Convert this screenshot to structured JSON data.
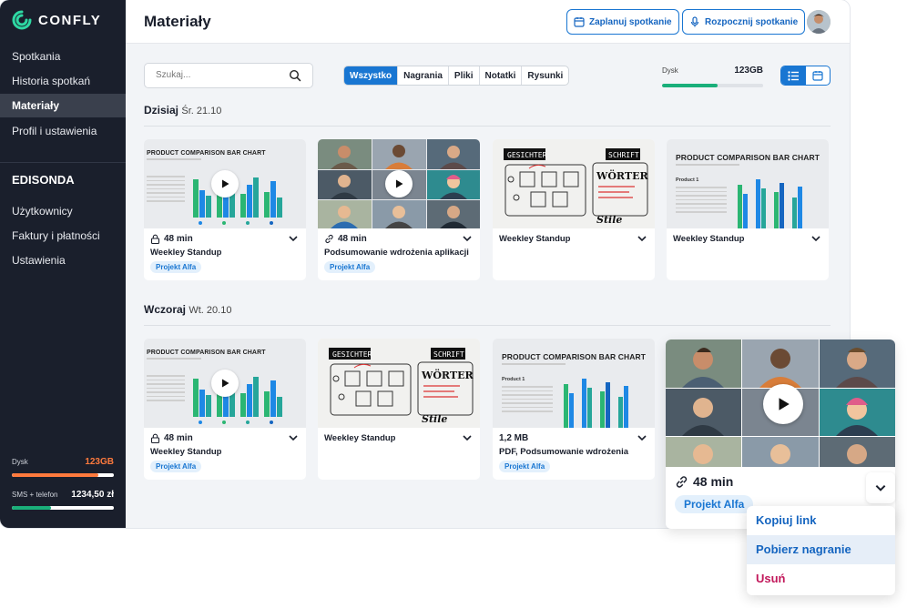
{
  "brand": {
    "name": "CONFLY",
    "accent": "#1976d2",
    "logo_color": "#2ed8a3"
  },
  "sidebar": {
    "items": [
      {
        "label": "Spotkania"
      },
      {
        "label": "Historia spotkań"
      },
      {
        "label": "Materiały",
        "active": true
      },
      {
        "label": "Profil i ustawienia"
      }
    ],
    "org_name": "EDISONDA",
    "org_items": [
      {
        "label": "Użytkownicy"
      },
      {
        "label": "Faktury i płatności"
      },
      {
        "label": "Ustawienia"
      }
    ],
    "usage": [
      {
        "label": "Dysk",
        "value": "123GB",
        "value_color": "#ff7a3d",
        "fill_fraction": 0.85,
        "bar_color": "#ff7a3d"
      },
      {
        "label": "SMS + telefon",
        "value": "1234,50 zł",
        "value_color": "#ffffff",
        "fill_fraction": 0.38,
        "bar_color": "#1aaf7a"
      }
    ]
  },
  "header": {
    "title": "Materiały",
    "schedule_button": "Zaplanuj spotkanie",
    "start_button": "Rozpocznij spotkanie"
  },
  "toolbar": {
    "search_placeholder": "Szukaj...",
    "filters": [
      "Wszystko",
      "Nagrania",
      "Pliki",
      "Notatki",
      "Rysunki"
    ],
    "active_filter": "Wszystko",
    "disk": {
      "label": "Dysk",
      "value": "123GB",
      "fill_fraction": 0.55,
      "bar_color": "#1aaf7a"
    },
    "view": "list"
  },
  "sections": [
    {
      "day": "Dzisiaj",
      "date": "Śr. 21.10",
      "cards": [
        {
          "kind": "chart-video",
          "icon": "lock-icon",
          "meta": "48 min",
          "title": "Weekley Standup",
          "tag": "Projekt Alfa"
        },
        {
          "kind": "people-video",
          "icon": "link-icon",
          "meta": "48 min",
          "title": "Podsumowanie wdrożenia aplikacji",
          "tag": "Projekt Alfa"
        },
        {
          "kind": "sketch",
          "title": "Weekley Standup"
        },
        {
          "kind": "chart-doc",
          "title": "Weekley Standup"
        }
      ]
    },
    {
      "day": "Wczoraj",
      "date": "Wt. 20.10",
      "cards": [
        {
          "kind": "chart-video",
          "icon": "lock-icon",
          "meta": "48 min",
          "title": "Weekley Standup",
          "tag": "Projekt Alfa"
        },
        {
          "kind": "sketch",
          "title": "Weekley Standup"
        },
        {
          "kind": "chart-doc",
          "meta": "1,2 MB",
          "title": "PDF, Podsumowanie wdrożenia",
          "tag": "Projekt Alfa"
        }
      ]
    }
  ],
  "thumb_text": {
    "chart_title": "PRODUCT COMPARISON BAR CHART",
    "product": "Product 1",
    "sketch_a": "GESICHTER",
    "sketch_b": "SCHRIFT",
    "sketch_c": "WÖRTER",
    "sketch_d": "Stile"
  },
  "expanded_card": {
    "meta": "48 min",
    "tag": "Projekt Alfa",
    "icon": "link-icon"
  },
  "context_menu": {
    "items": [
      "Kopiuj link",
      "Pobierz nagranie",
      "Usuń"
    ],
    "highlighted": "Pobierz nagranie"
  }
}
